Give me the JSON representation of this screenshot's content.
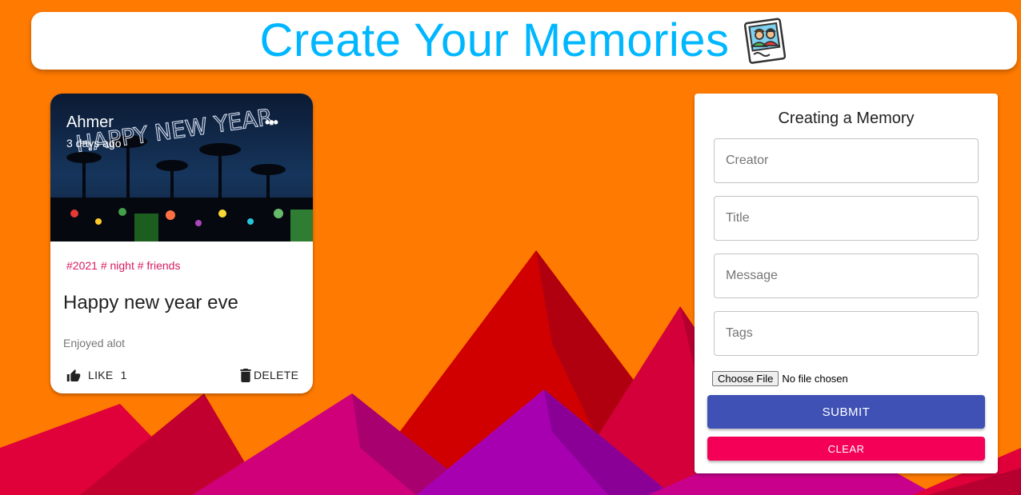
{
  "app": {
    "title": "Create Your Memories",
    "icon": "photo-memories-icon"
  },
  "card": {
    "creator": "Ahmer",
    "time_ago": "3 days ago",
    "image_text": "HAPPY NEW YEAR",
    "more_icon": "more-horiz-icon",
    "tags": "#2021 # night # friends",
    "title": "Happy new year eve",
    "message": "Enjoyed alot",
    "like_label": "LIKE",
    "like_count": "1",
    "like_icon": "thumb-up-icon",
    "delete_label": "DELETE",
    "delete_icon": "trash-icon"
  },
  "form": {
    "heading": "Creating a Memory",
    "creator_placeholder": "Creator",
    "title_placeholder": "Title",
    "message_placeholder": "Message",
    "tags_placeholder": "Tags",
    "file_button": "Choose File",
    "file_status": "No file chosen",
    "submit_label": "SUBMIT",
    "clear_label": "CLEAR"
  },
  "colors": {
    "background": "#ff7a00",
    "title": "#00b7ff",
    "submit": "#3f51b5",
    "clear": "#f50057",
    "tags": "#d81b60"
  }
}
